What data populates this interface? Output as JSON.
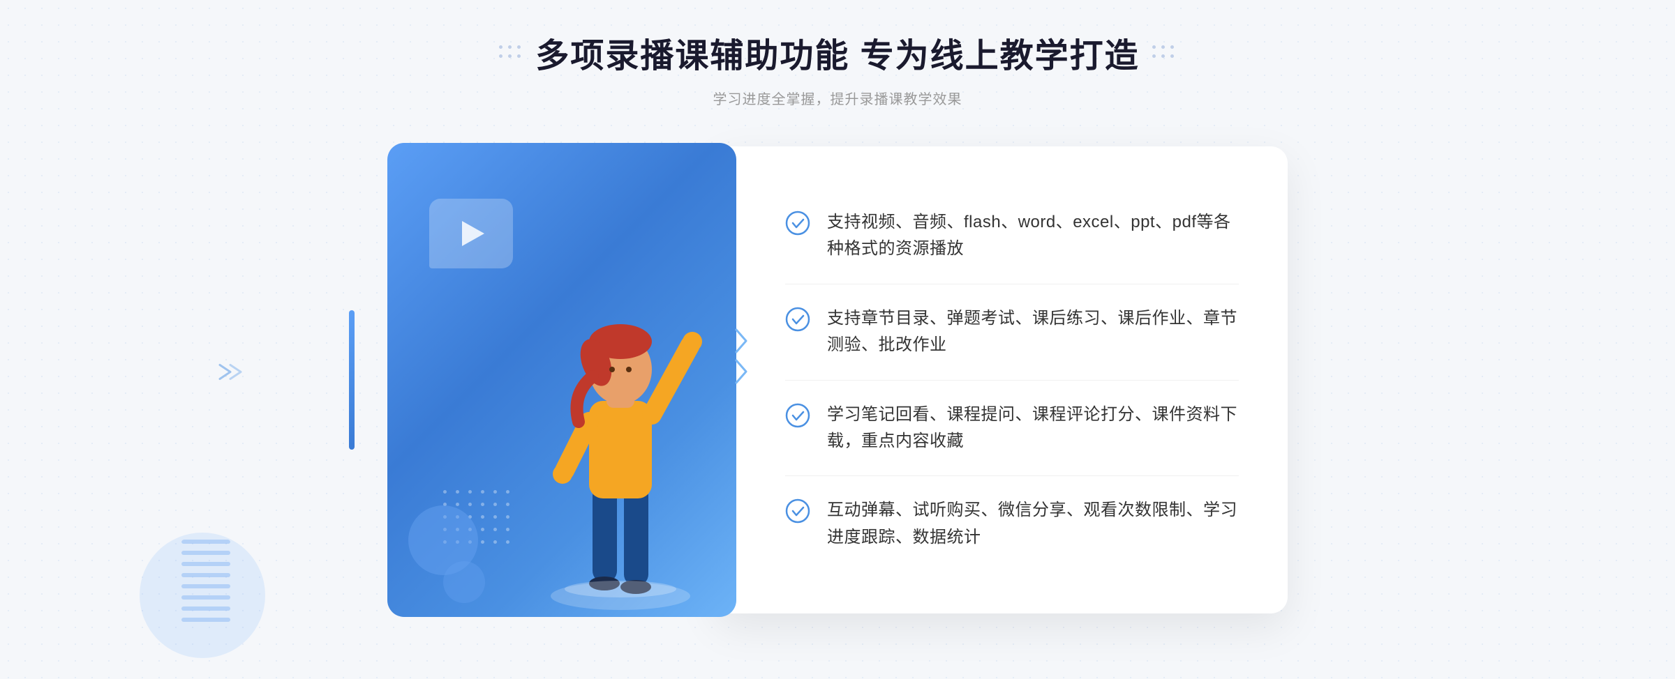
{
  "header": {
    "title": "多项录播课辅助功能 专为线上教学打造",
    "subtitle": "学习进度全掌握，提升录播课教学效果"
  },
  "features": [
    {
      "id": "feature-1",
      "text": "支持视频、音频、flash、word、excel、ppt、pdf等各种格式的资源播放"
    },
    {
      "id": "feature-2",
      "text": "支持章节目录、弹题考试、课后练习、课后作业、章节测验、批改作业"
    },
    {
      "id": "feature-3",
      "text": "学习笔记回看、课程提问、课程评论打分、课件资料下载，重点内容收藏"
    },
    {
      "id": "feature-4",
      "text": "互动弹幕、试听购买、微信分享、观看次数限制、学习进度跟踪、数据统计"
    }
  ],
  "colors": {
    "primary_blue": "#4a90e2",
    "dark_blue": "#3a7bd5",
    "light_blue": "#6db3f7",
    "text_dark": "#1a1a2e",
    "text_gray": "#999999",
    "text_body": "#333333",
    "check_color": "#4a90e2"
  }
}
